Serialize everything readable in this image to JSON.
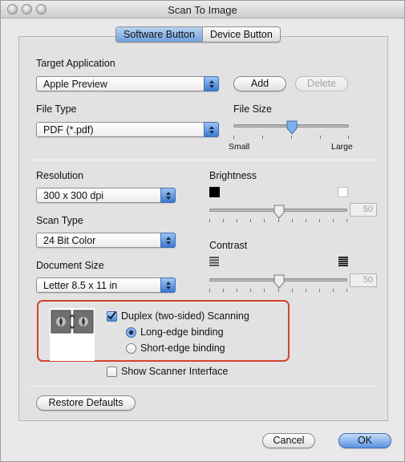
{
  "window": {
    "title": "Scan To Image"
  },
  "tabs": [
    {
      "label": "Software Button",
      "active": true
    },
    {
      "label": "Device Button",
      "active": false
    }
  ],
  "target_application": {
    "label": "Target Application",
    "selected": "Apple Preview",
    "add_label": "Add",
    "delete_label": "Delete"
  },
  "file_type": {
    "label": "File Type",
    "selected": "PDF (*.pdf)"
  },
  "file_size": {
    "label": "File Size",
    "min_label": "Small",
    "max_label": "Large",
    "level_fraction": 0.5
  },
  "resolution": {
    "label": "Resolution",
    "selected": "300 x 300 dpi"
  },
  "scan_type": {
    "label": "Scan Type",
    "selected": "24 Bit Color"
  },
  "document_size": {
    "label": "Document Size",
    "selected": "Letter  8.5 x 11 in"
  },
  "brightness": {
    "label": "Brightness",
    "value": "50",
    "level_fraction": 0.5
  },
  "contrast": {
    "label": "Contrast",
    "value": "50",
    "level_fraction": 0.5
  },
  "duplex": {
    "label": "Duplex (two-sided) Scanning",
    "checked": true,
    "options": [
      {
        "label": "Long-edge binding",
        "selected": true
      },
      {
        "label": "Short-edge binding",
        "selected": false
      }
    ]
  },
  "show_scanner_interface": {
    "label": "Show Scanner Interface",
    "checked": false
  },
  "restore_defaults_label": "Restore Defaults",
  "cancel_label": "Cancel",
  "ok_label": "OK",
  "colors": {
    "accent": "#4f86d8",
    "highlight_border": "#d0452f"
  }
}
